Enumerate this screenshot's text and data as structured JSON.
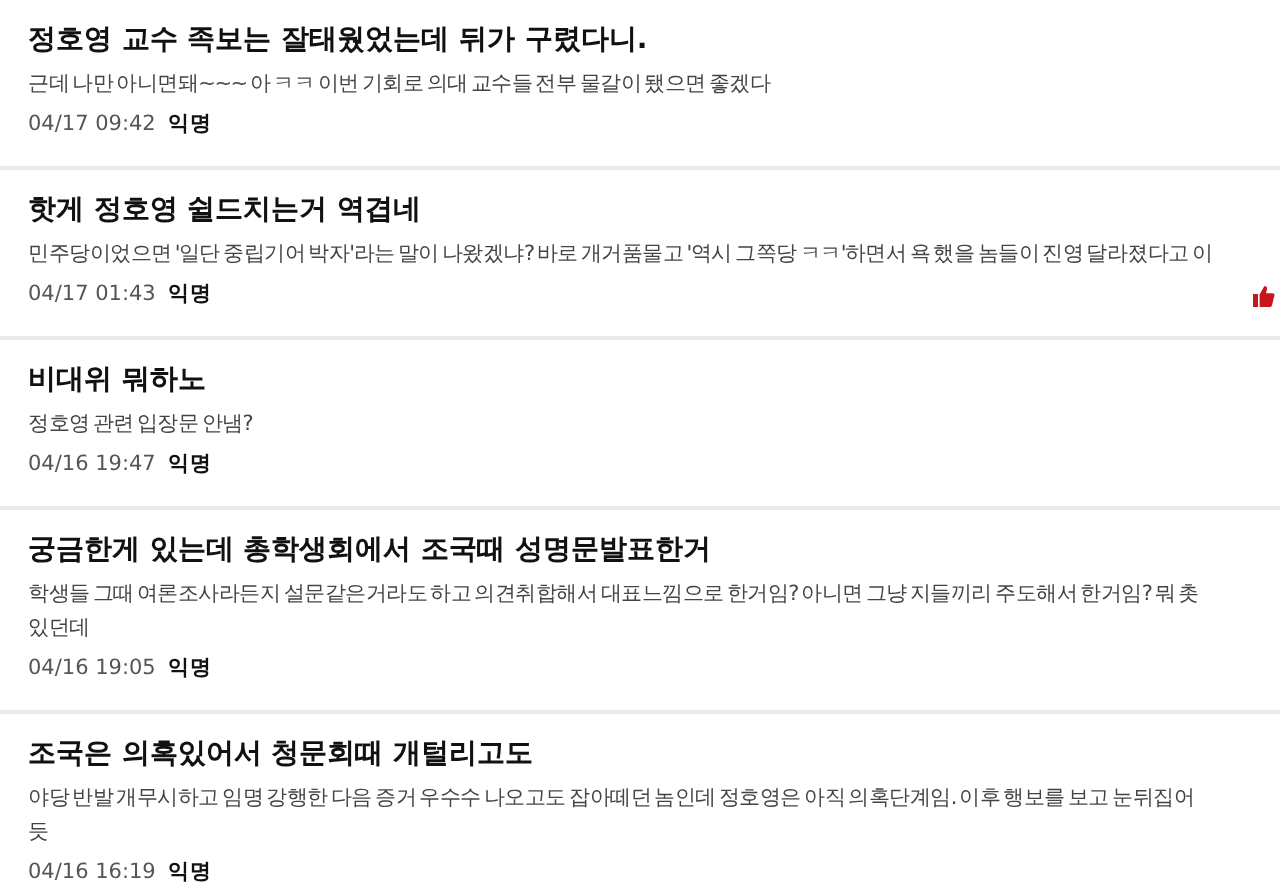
{
  "posts": [
    {
      "title": "정호영 교수 족보는 잘태웠었는데 뒤가 구렸다니.",
      "body": [
        "근데 나만 아니면돼~~~ 아 ㅋㅋ 이번 기회로 의대 교수들 전부 물갈이 됐으면 좋겠다"
      ],
      "time": "04/17 09:42",
      "author": "익명",
      "vote_icon": false
    },
    {
      "title": "핫게 정호영 쉴드치는거 역겹네",
      "body": [
        "민주당이었으면 '일단 중립기어 박자'라는 말이 나왔겠냐? 바로 개거품물고 '역시 그쪽당 ㅋㅋ'하면서 욕 했을 놈들이 진영 달라졌다고 이"
      ],
      "time": "04/17 01:43",
      "author": "익명",
      "vote_icon": true
    },
    {
      "title": "비대위 뭐하노",
      "body": [
        "정호영 관련 입장문 안냄?"
      ],
      "time": "04/16 19:47",
      "author": "익명",
      "vote_icon": false
    },
    {
      "title": "궁금한게 있는데 총학생회에서 조국때 성명문발표한거",
      "body": [
        "학생들 그때 여론조사라든지 설문같은거라도 하고 의견취합해서 대표느낌으로 한거임? 아니면 그냥 지들끼리 주도해서 한거임? 뭐 촛",
        "있던데"
      ],
      "time": "04/16 19:05",
      "author": "익명",
      "vote_icon": false
    },
    {
      "title": "조국은 의혹있어서 청문회때 개털리고도",
      "body": [
        "야당 반발 개무시하고 임명 강행한 다음 증거 우수수 나오고도 잡아떼던 놈인데 정호영은 아직 의혹단계임. 이후 행보를 보고 눈뒤집어",
        "듯"
      ],
      "time": "04/16 16:19",
      "author": "익명",
      "vote_icon": false
    }
  ]
}
